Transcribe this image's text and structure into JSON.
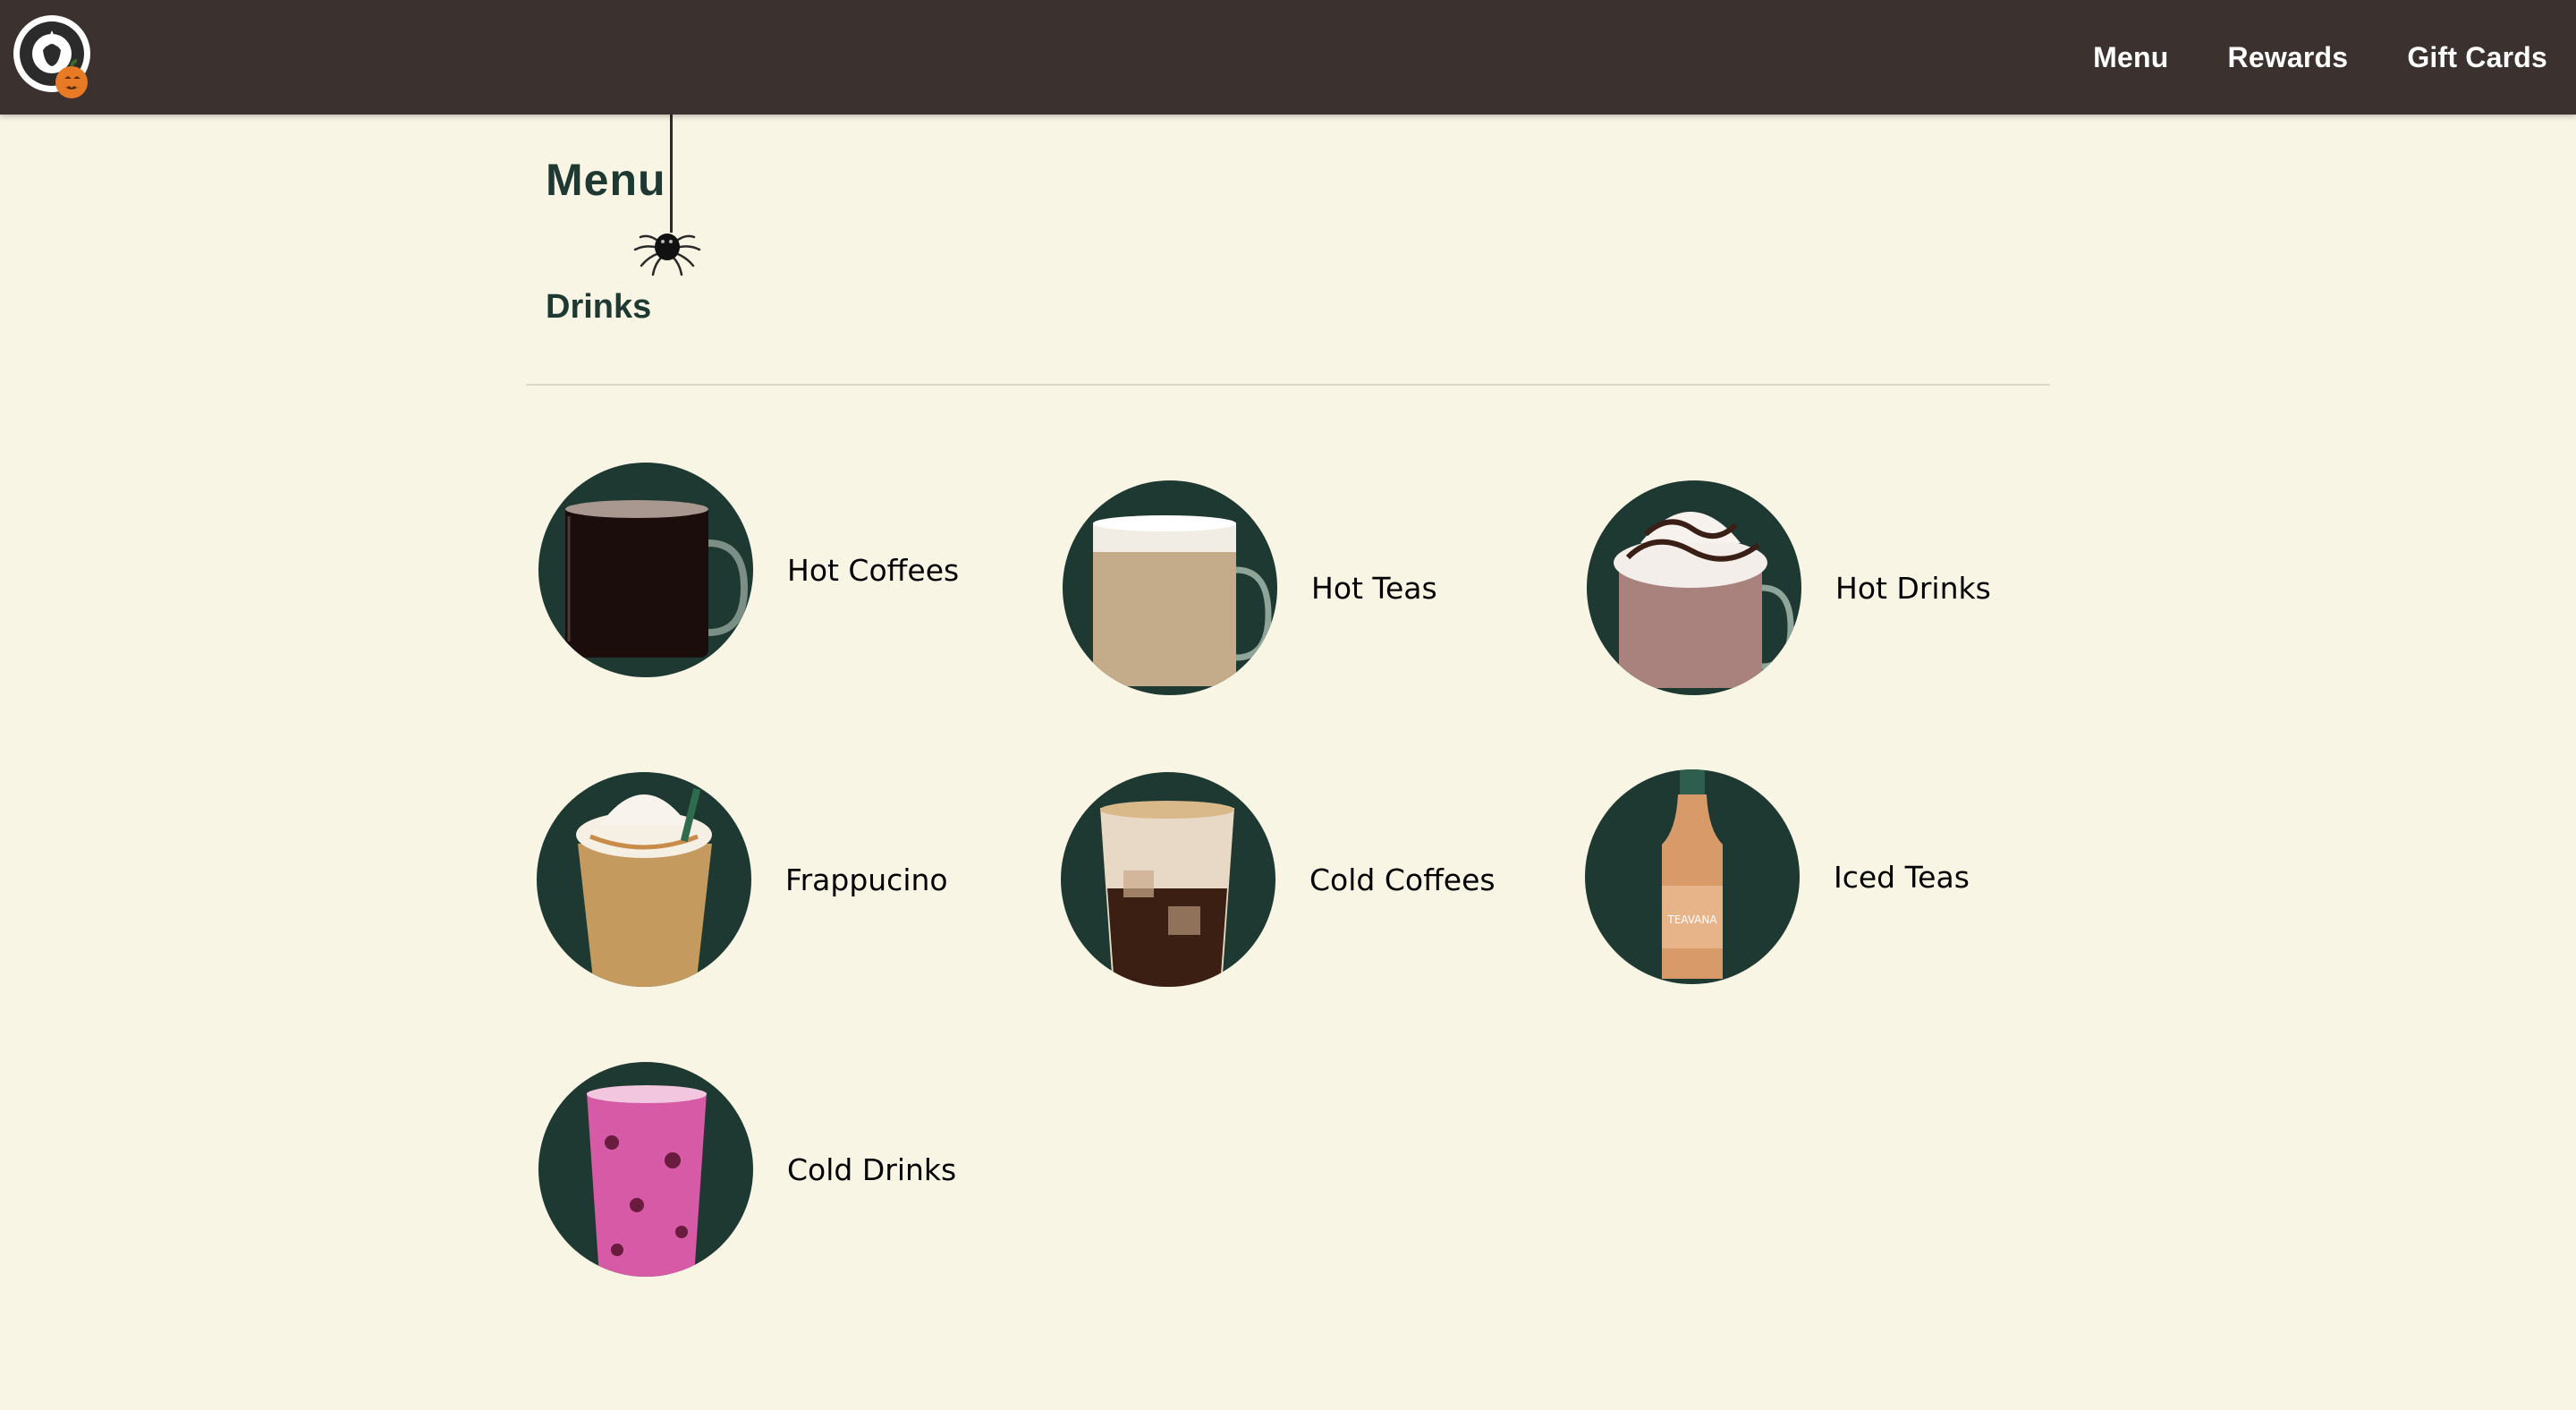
{
  "navbar": {
    "logo": "siren-logo-with-pumpkin",
    "links": [
      {
        "label": "Menu"
      },
      {
        "label": "Rewards"
      },
      {
        "label": "Gift Cards"
      }
    ]
  },
  "page": {
    "title": "Menu",
    "section": "Drinks"
  },
  "categories": [
    {
      "label": "Hot Coffees",
      "icon": "hot-coffee-mug"
    },
    {
      "label": "Hot Teas",
      "icon": "hot-tea-latte-mug"
    },
    {
      "label": "Hot Drinks",
      "icon": "hot-chocolate-mug"
    },
    {
      "label": "Frappucino",
      "icon": "frappuccino-cup"
    },
    {
      "label": "Cold Coffees",
      "icon": "iced-coffee-cup"
    },
    {
      "label": "Iced Teas",
      "icon": "iced-tea-bottle"
    },
    {
      "label": "Cold Drinks",
      "icon": "pink-drink-cup"
    }
  ],
  "colors": {
    "nav_background": "#3b3230",
    "page_background": "#f9f5e5",
    "brand_green": "#1e3932"
  }
}
